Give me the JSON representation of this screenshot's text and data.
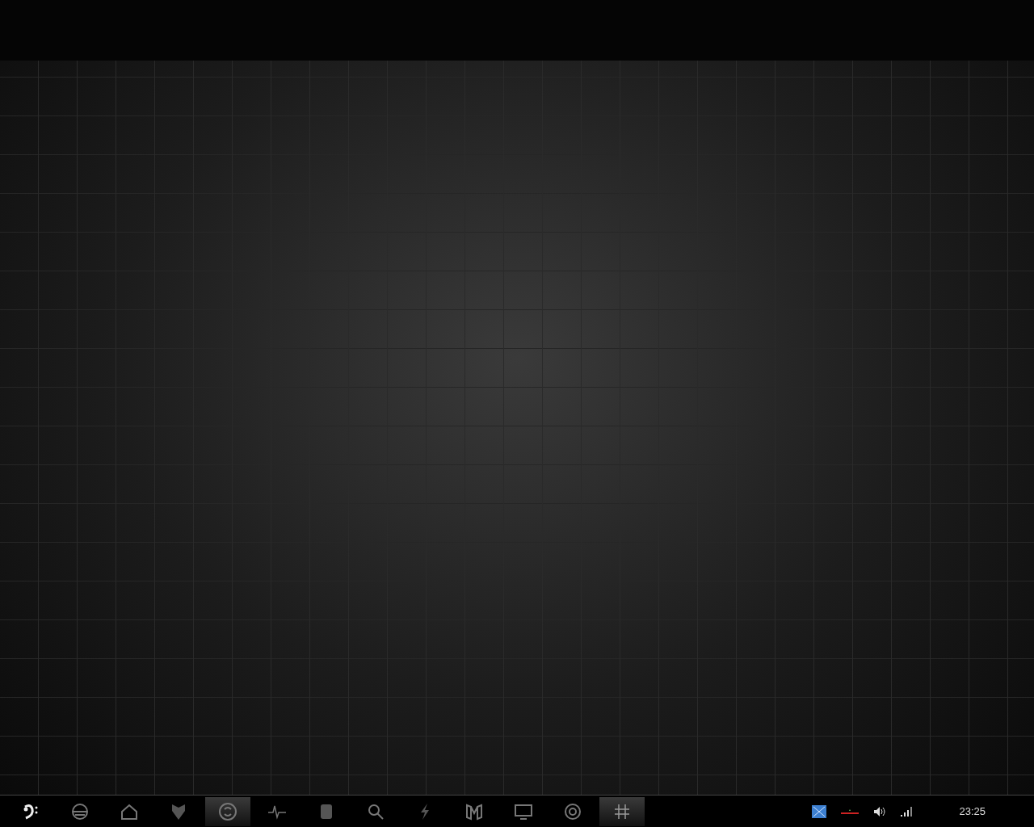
{
  "taskbar": {
    "launchers": [
      {
        "kind": "clef",
        "selected": false
      },
      {
        "kind": "globe",
        "selected": false
      },
      {
        "kind": "house",
        "selected": false
      },
      {
        "kind": "shield",
        "selected": false
      },
      {
        "kind": "disc",
        "selected": true
      },
      {
        "kind": "pulse",
        "selected": false
      },
      {
        "kind": "notebook",
        "selected": false
      },
      {
        "kind": "search",
        "selected": false
      },
      {
        "kind": "bolt",
        "selected": false
      },
      {
        "kind": "book",
        "selected": false
      },
      {
        "kind": "monitor",
        "selected": false
      },
      {
        "kind": "ring",
        "selected": false
      },
      {
        "kind": "grid",
        "selected": true
      }
    ],
    "tray": {
      "clock": "23:25"
    }
  }
}
